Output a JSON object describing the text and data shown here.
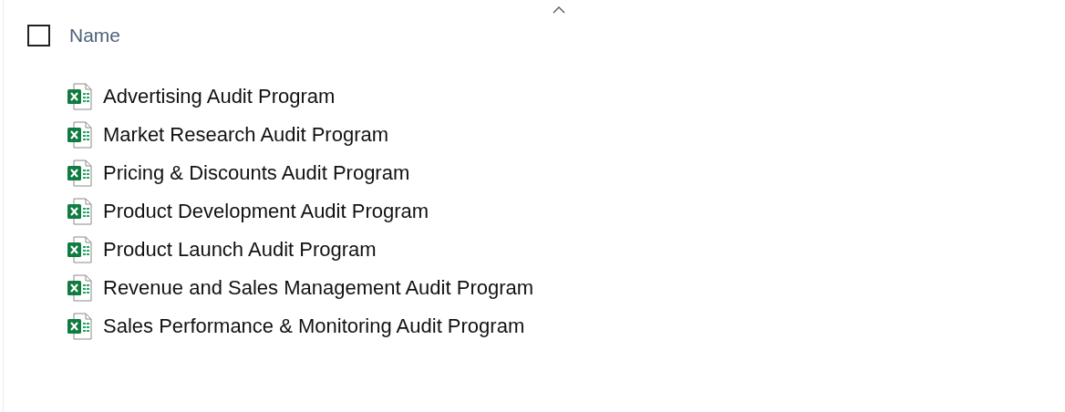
{
  "header": {
    "label": "Name",
    "checked": false
  },
  "files": [
    {
      "name": "Advertising Audit Program"
    },
    {
      "name": "Market Research Audit Program"
    },
    {
      "name": "Pricing & Discounts Audit Program"
    },
    {
      "name": "Product Development Audit Program"
    },
    {
      "name": "Product Launch Audit Program"
    },
    {
      "name": "Revenue and Sales Management Audit Program"
    },
    {
      "name": "Sales Performance & Monitoring Audit Program"
    }
  ]
}
